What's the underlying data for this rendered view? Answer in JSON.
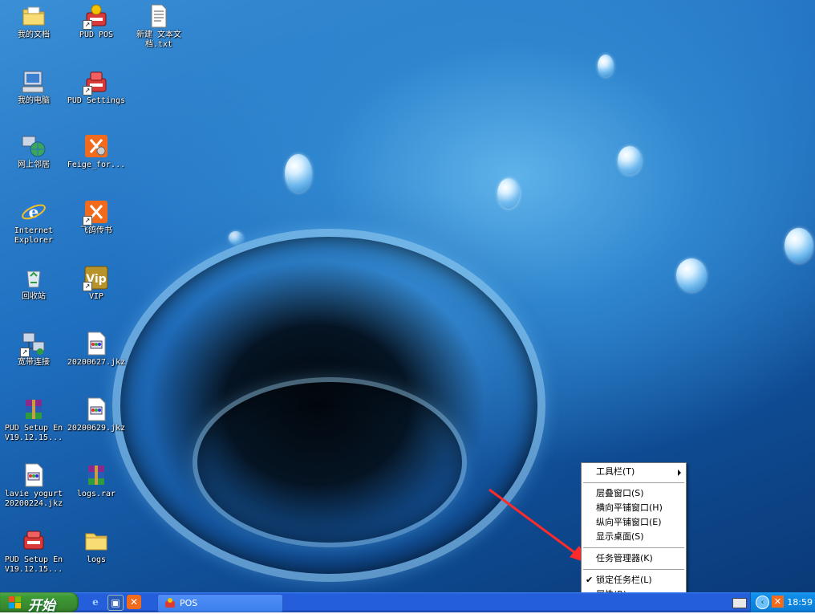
{
  "desktop": {
    "icons": [
      {
        "label": "我的文档"
      },
      {
        "label": "PUD POS"
      },
      {
        "label": "新建 文本文\n档.txt"
      },
      {
        "label": "我的电脑"
      },
      {
        "label": "PUD Settings"
      },
      {
        "label": "网上邻居"
      },
      {
        "label": "Feige_for..."
      },
      {
        "label": "Internet\nExplorer"
      },
      {
        "label": "飞鸽传书"
      },
      {
        "label": "回收站"
      },
      {
        "label": "VIP"
      },
      {
        "label": "宽带连接"
      },
      {
        "label": "20200627.jkz"
      },
      {
        "label": "PUD Setup En\nV19.12.15..."
      },
      {
        "label": "20200629.jkz"
      },
      {
        "label": "lavie yogurt\n20200224.jkz"
      },
      {
        "label": "logs.rar"
      },
      {
        "label": "PUD Setup En\nV19.12.15..."
      },
      {
        "label": "logs"
      }
    ]
  },
  "context_menu": {
    "items": [
      {
        "label": "工具栏(T)"
      },
      {
        "label": "层叠窗口(S)"
      },
      {
        "label": "横向平铺窗口(H)"
      },
      {
        "label": "纵向平铺窗口(E)"
      },
      {
        "label": "显示桌面(S)"
      },
      {
        "label": "任务管理器(K)"
      },
      {
        "label": "锁定任务栏(L)"
      },
      {
        "label": "属性(R)"
      }
    ]
  },
  "taskbar": {
    "start_label": "开始",
    "task_button_label": "POS",
    "clock": "18:59"
  },
  "colors": {
    "taskbar_blue": "#245edb",
    "start_green": "#3c9b34",
    "tray_blue": "#0f8de8",
    "annotation_red": "#ff2a2a"
  }
}
